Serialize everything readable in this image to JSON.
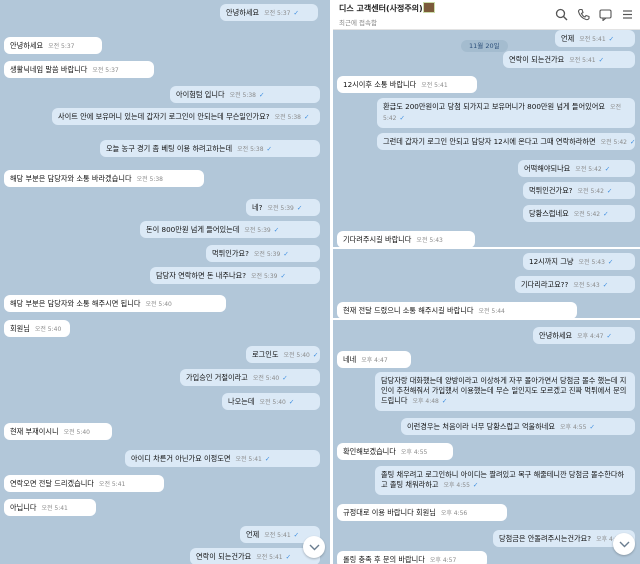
{
  "left": {
    "messages": [
      {
        "text": "안녕하세요",
        "time": "오전 5:37",
        "side": "out"
      },
      {
        "text": "안녕하세요",
        "time": "오전 5:37",
        "side": "in"
      },
      {
        "text": "생활닉네임 말씀 바랍니다",
        "time": "오전 5:37",
        "side": "in"
      },
      {
        "text": "아이험텀 입니다",
        "time": "오전 5:38",
        "side": "out"
      },
      {
        "text": "사이트 안에 보유머니 있는데 갑자기 로그인이 안되는데 무슨일인가요?",
        "time": "오전 5:38",
        "side": "out"
      },
      {
        "text": "오늘 농구 경기 좀 베팅 이용 하려고하는데",
        "time": "오전 5:38",
        "side": "out"
      },
      {
        "text": "해당 부분은 담당자와 소통 바라겠습니다",
        "time": "오전 5:38",
        "side": "in"
      },
      {
        "text": "네?",
        "time": "오전 5:39",
        "side": "out"
      },
      {
        "text": "돈이 800만원 넘게 들어있는데",
        "time": "오전 5:39",
        "side": "out"
      },
      {
        "text": "먹튀인가요?",
        "time": "오전 5:39",
        "side": "out"
      },
      {
        "text": "담당자 연락하면 돈 내주나요?",
        "time": "오전 5:39",
        "side": "out"
      },
      {
        "text": "해당 부분은 담당자와 소통 해주시면 됩니다",
        "time": "오전 5:40",
        "side": "in"
      },
      {
        "text": "회원님",
        "time": "오전 5:40",
        "side": "in"
      },
      {
        "text": "로그인도",
        "time": "오전 5:40",
        "side": "out"
      },
      {
        "text": "가입승인 거절이라고",
        "time": "오전 5:40",
        "side": "out"
      },
      {
        "text": "나오는데",
        "time": "오전 5:40",
        "side": "out"
      },
      {
        "text": "현재 부재이시니",
        "time": "오전 5:40",
        "side": "in"
      },
      {
        "text": "아이디 차른거 아닌가요 이정도면",
        "time": "오전 5:41",
        "side": "out"
      },
      {
        "text": "연락오면 전달 드리겠습니다",
        "time": "오전 5:41",
        "side": "in"
      },
      {
        "text": "아닙니다",
        "time": "오전 5:41",
        "side": "in"
      },
      {
        "text": "언제",
        "time": "오전 5:41",
        "side": "out"
      },
      {
        "text": "연락이 되는건가요",
        "time": "오전 5:41",
        "side": "out"
      }
    ]
  },
  "right": {
    "header": {
      "title": "디스 고객센터(사정주의)",
      "subtitle": "최근에 접속함"
    },
    "date_label": "11월 20일",
    "messages": [
      {
        "text": "언제",
        "time": "오전 5:41",
        "side": "out"
      },
      {
        "text": "연락이 되는건가요",
        "time": "오전 5:41",
        "side": "out"
      },
      {
        "text": "12시이후 소통 바랍니다",
        "time": "오전 5:41",
        "side": "in"
      },
      {
        "text": "환급도 200만원이고 당첨 되가지고 보유머니가 800만원 넘게 들어있어요",
        "time": "오전 5:42",
        "side": "out"
      },
      {
        "text": "그런데 갑자기 로그인 안되고 담당자 12시에 온다고 그때 연락하라하면",
        "time": "오전 5:42",
        "side": "out"
      },
      {
        "text": "어떡해야되나요",
        "time": "오전 5:42",
        "side": "out"
      },
      {
        "text": "먹튀인건가요?",
        "time": "오전 5:42",
        "side": "out"
      },
      {
        "text": "당황스럽네요",
        "time": "오전 5:42",
        "side": "out"
      },
      {
        "text": "기다려주시길 바랍니다",
        "time": "오전 5:43",
        "side": "in"
      },
      {
        "text": "12시까지 그냥",
        "time": "오전 5:43",
        "side": "out"
      },
      {
        "text": "기다리라고요??",
        "time": "오전 5:43",
        "side": "out"
      },
      {
        "text": "현재 전달 드렸으니 소통 해주시길 바랍니다",
        "time": "오전 5:44",
        "side": "in"
      },
      {
        "text": "안녕하세요",
        "time": "오후 4:47",
        "side": "out"
      },
      {
        "text": "네네",
        "time": "오후 4:47",
        "side": "in"
      },
      {
        "text": "담당자랑 대화했는데 양방이라고 이상하게 자꾸 몰아가면서 당첨금 몰수 했는데 지인이 추천해줘서 가입했서 이용했는데 무슨 일인지도 모르겠고 진짜 먹튀에서 문의드립니다",
        "time": "오후 4:48",
        "side": "out"
      },
      {
        "text": "이런경우는 처음이라 너무 당황스럽고 억울하네요",
        "time": "오후 4:55",
        "side": "out"
      },
      {
        "text": "확인해보겠습니다",
        "time": "오후 4:55",
        "side": "in"
      },
      {
        "text": "졸팅 채우려고 로그인하니 아이디는 짤려있고 복구 해줄테니깐 당첨금 몰수한다하고 졸팅 채워라하고",
        "time": "오후 4:55",
        "side": "out"
      },
      {
        "text": "규정대로 이용 바랍니다 회원님",
        "time": "오후 4:56",
        "side": "in"
      },
      {
        "text": "당첨금은 안돌려주시는건가요?",
        "time": "오후 4:57",
        "side": "out"
      },
      {
        "text": "롤링 충족 후 문의 바랍니다",
        "time": "오후 4:57",
        "side": "in"
      }
    ]
  },
  "icons": {
    "search": "search-icon",
    "call": "phone-icon",
    "menu": "menu-icon",
    "scroll_down": "chevron-down-icon",
    "read": "check-icon"
  },
  "colors": {
    "chat_background": "#b2c7d9",
    "incoming_bubble": "#ffffff",
    "outgoing_bubble": "#dbe9f6",
    "read_check": "#3c8de0"
  }
}
